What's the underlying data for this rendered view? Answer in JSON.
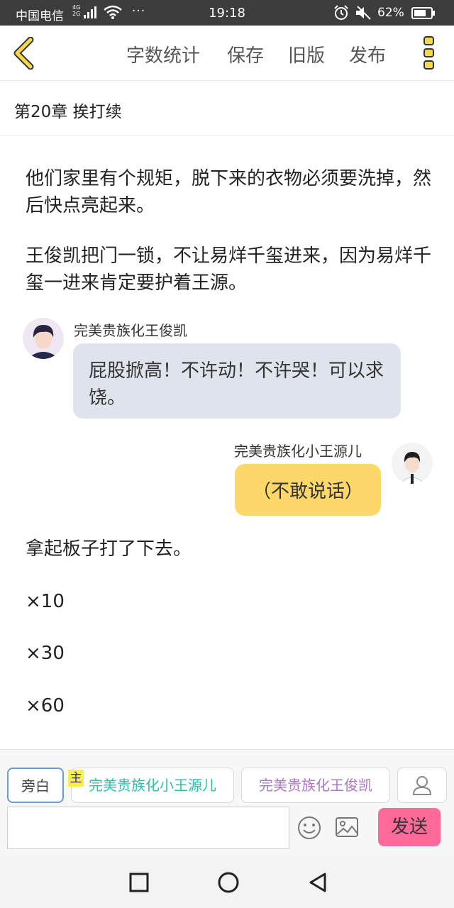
{
  "status_bar": {
    "carrier": "中国电信",
    "network_top": "4G",
    "network_bottom": "2G",
    "overflow": "···",
    "time": "19:18",
    "battery": "62%",
    "icons": [
      "signal-icon",
      "wifi-icon",
      "alarm-icon",
      "mute-icon",
      "battery-icon"
    ]
  },
  "toolbar": {
    "word_count": "字数统计",
    "save": "保存",
    "old_version": "旧版",
    "publish": "发布",
    "accent": "#f5c518"
  },
  "chapter": {
    "title": "第20章  挨打续"
  },
  "content": {
    "para1": "他们家里有个规矩，脱下来的衣物必须要洗掉，然后快点亮起来。",
    "para2": "王俊凯把门一锁，不让易烊千玺进来，因为易烊千玺一进来肯定要护着王源。",
    "msg1": {
      "speaker": "完美贵族化王俊凯",
      "text": "屁股掀高！不许动！不许哭！可以求饶。",
      "bubble_color": "#dfe4ec"
    },
    "msg2": {
      "speaker": "完美贵族化小王源儿",
      "text": "（不敢说话）",
      "bubble_color": "#fcd76a"
    },
    "para3": "拿起板子打了下去。",
    "count1": "×10",
    "count2": "×30",
    "count3": "×60"
  },
  "panel": {
    "narration": "旁白",
    "main_tag": "主",
    "char_a": "完美贵族化小王源儿",
    "char_b": "完美贵族化王俊凯",
    "input_placeholder": "",
    "send": "发送",
    "send_color": "#ff6a9a"
  }
}
